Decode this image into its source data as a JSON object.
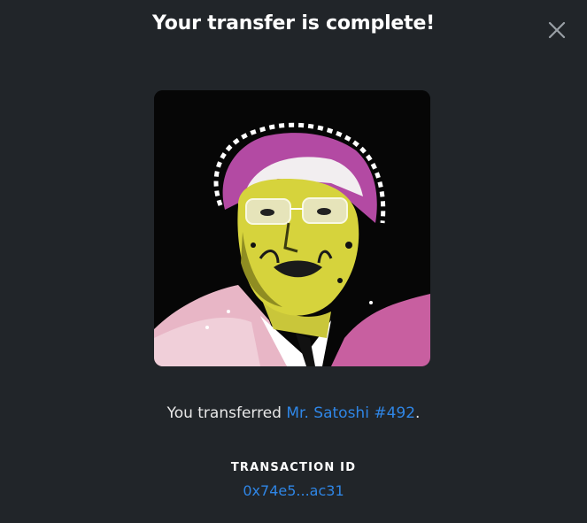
{
  "modal": {
    "title": "Your transfer is complete!",
    "close_icon": "close-icon"
  },
  "nft": {
    "name": "Mr. Satoshi #492"
  },
  "message": {
    "prefix": "You transferred ",
    "item_link": "Mr. Satoshi #492",
    "suffix": "."
  },
  "transaction": {
    "label": "TRANSACTION ID",
    "id": "0x74e5...ac31"
  },
  "colors": {
    "background": "#212529",
    "link": "#2f86e6",
    "text": "#ffffff"
  }
}
